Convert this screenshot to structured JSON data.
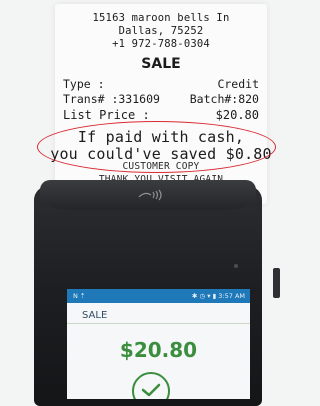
{
  "receipt": {
    "address_line1": "15163 maroon bells In",
    "address_line2": "Dallas, 75252",
    "phone": "+1 972-788-0304",
    "title": "SALE",
    "type_label": "Type :",
    "type_value": "Credit",
    "trans_label": "Trans# :331609",
    "batch_label": "Batch#:820",
    "list_price_label": "List Price :",
    "list_price_value": "$20.80",
    "cash_line1": "If paid with cash,",
    "cash_line2": "you could've saved $0.80",
    "copy_label": "CUSTOMER COPY",
    "thanks": "THANK YOU VISIT AGAIN"
  },
  "terminal": {
    "status_time": "3:57 AM",
    "status_icons_left": "N ⇡",
    "status_icons_right": "✱ ◷ ▾ ▮",
    "screen_title": "SALE",
    "amount": "$20.80",
    "nfc_icon": "contactless-icon"
  },
  "colors": {
    "highlight_oval": "#d92a32",
    "status_bar": "#1f78b8",
    "amount_green": "#3a8e3e"
  }
}
